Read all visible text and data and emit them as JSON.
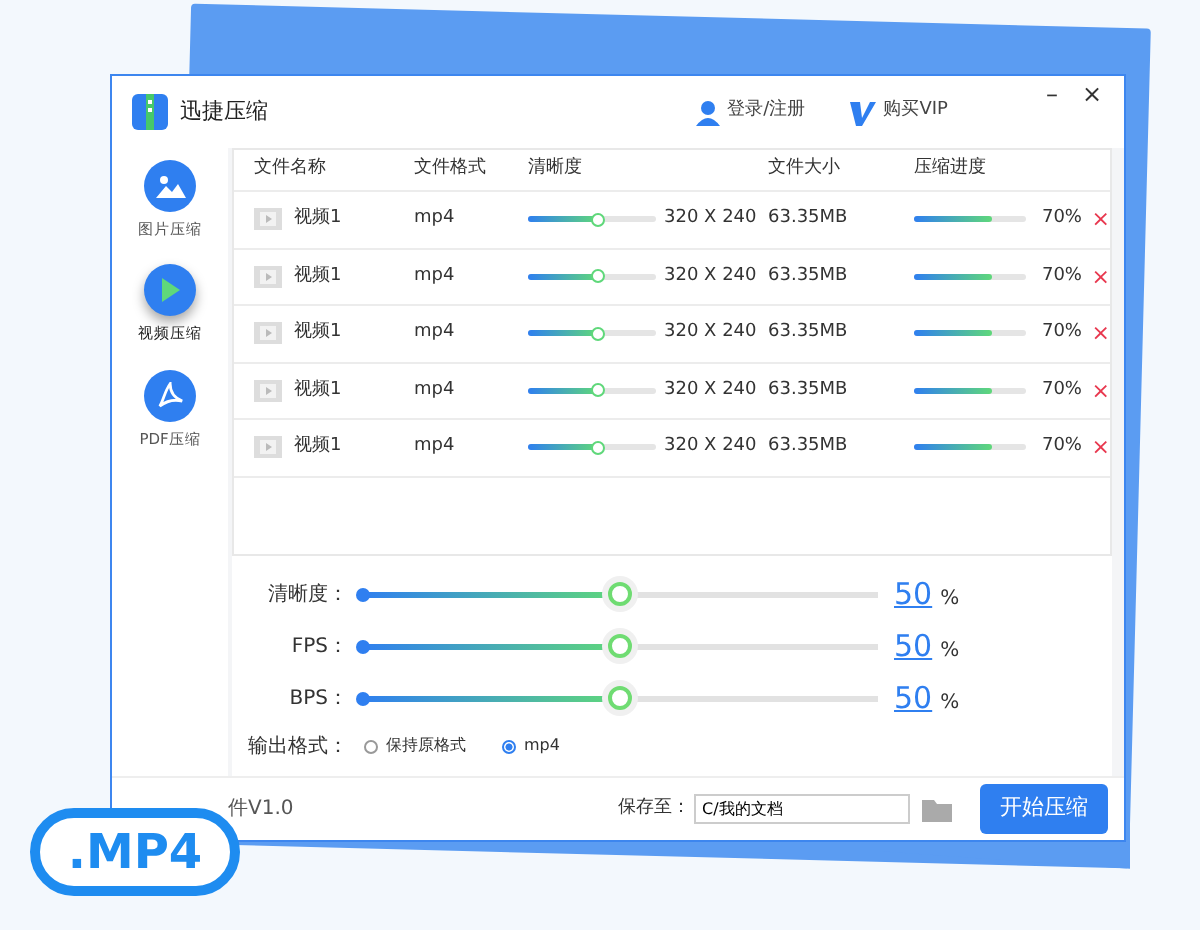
{
  "app": {
    "title": "迅捷压缩",
    "login": "登录/注册",
    "vip": "购买VIP",
    "minimize": "–",
    "close": "×"
  },
  "sidebar": {
    "items": [
      {
        "kind": "image",
        "label": "图片压缩",
        "selected": false
      },
      {
        "kind": "video",
        "label": "视频压缩",
        "selected": true
      },
      {
        "kind": "pdf",
        "label": "PDF压缩",
        "selected": false
      }
    ]
  },
  "table": {
    "columns": [
      "文件名称",
      "文件格式",
      "清晰度",
      "文件大小",
      "压缩进度"
    ],
    "rows": [
      {
        "name": "视频1",
        "format": "mp4",
        "level": 0.55,
        "resolution": "320 X 240",
        "size": "63.35MB",
        "progress": {
          "level": 0.7,
          "text": "70%"
        },
        "remove": "×"
      },
      {
        "name": "视频1",
        "format": "mp4",
        "level": 0.55,
        "resolution": "320 X 240",
        "size": "63.35MB",
        "progress": {
          "level": 0.7,
          "text": "70%"
        },
        "remove": "×"
      },
      {
        "name": "视频1",
        "format": "mp4",
        "level": 0.55,
        "resolution": "320 X 240",
        "size": "63.35MB",
        "progress": {
          "level": 0.7,
          "text": "70%"
        },
        "remove": "×"
      },
      {
        "name": "视频1",
        "format": "mp4",
        "level": 0.55,
        "resolution": "320 X 240",
        "size": "63.35MB",
        "progress": {
          "level": 0.7,
          "text": "70%"
        },
        "remove": "×"
      },
      {
        "name": "视频1",
        "format": "mp4",
        "level": 0.55,
        "resolution": "320 X 240",
        "size": "63.35MB",
        "progress": {
          "level": 0.7,
          "text": "70%"
        },
        "remove": "×"
      }
    ]
  },
  "settings": {
    "sliders": [
      {
        "label": "清晰度：",
        "level": 0.5,
        "value": "50",
        "unit": "%"
      },
      {
        "label": "FPS：",
        "level": 0.5,
        "value": "50",
        "unit": "%"
      },
      {
        "label": "BPS：",
        "level": 0.5,
        "value": "50",
        "unit": "%"
      }
    ],
    "output": {
      "label": "输出格式：",
      "options": [
        {
          "label": "保持原格式",
          "selected": false
        },
        {
          "label": "mp4",
          "selected": true
        }
      ]
    }
  },
  "footer": {
    "version": "件V1.0",
    "save_label": "保存至：",
    "save_path": "C/我的文档",
    "start": "开始压缩"
  },
  "badge": ".MP4"
}
